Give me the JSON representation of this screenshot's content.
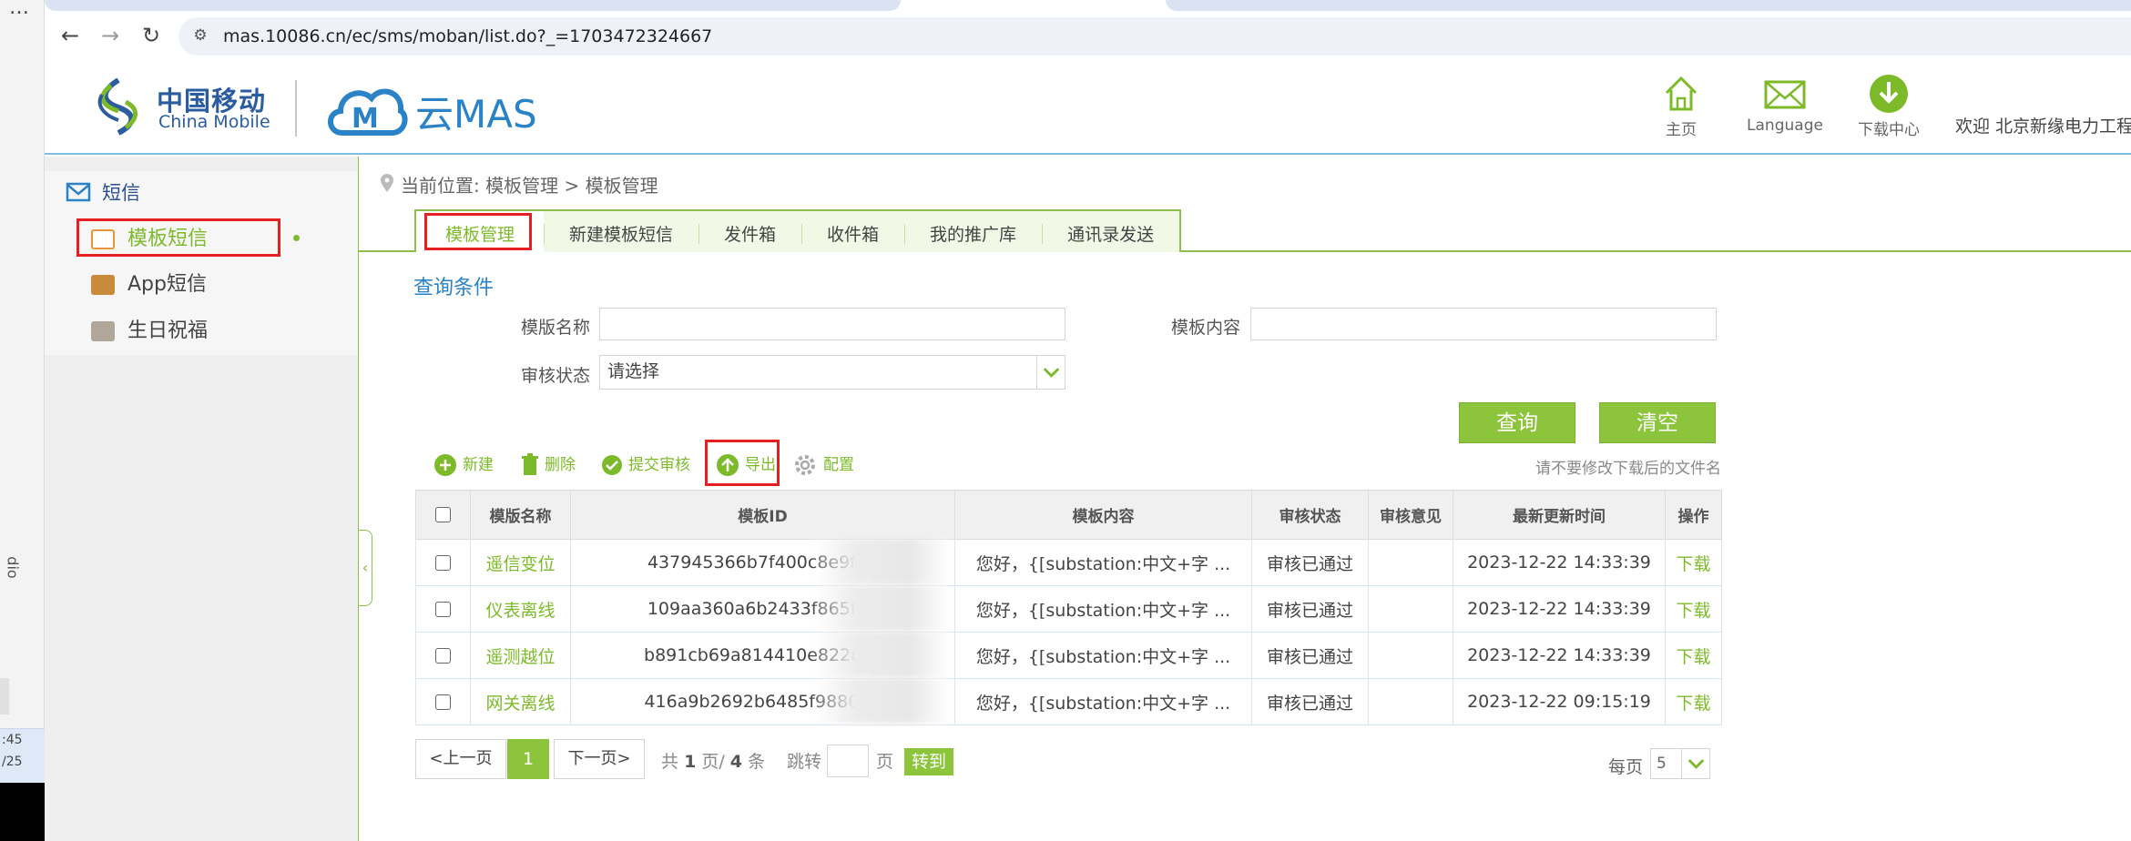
{
  "browser": {
    "menu_glyph": "…",
    "url": "mas.10086.cn/ec/sms/moban/list.do?_=1703472324667",
    "back_glyph": "←",
    "forward_glyph": "→",
    "reload_glyph": "↻",
    "site_info_glyph": "⚙"
  },
  "desktop": {
    "side_text": "dio",
    "clock_time": ":45",
    "clock_date": "/25"
  },
  "header": {
    "cm_zh": "中国移动",
    "cm_en": "China Mobile",
    "mas_text": "云MAS",
    "nav": [
      {
        "label": "主页",
        "icon": "home-icon"
      },
      {
        "label": "Language",
        "icon": "envelope-icon"
      },
      {
        "label": "下载中心",
        "icon": "download-icon"
      }
    ],
    "welcome": "欢迎 北京新缘电力工程"
  },
  "sidebar": {
    "section_title": "短信",
    "items": [
      {
        "label": "模板短信",
        "icon": "template-sms-icon",
        "active": true
      },
      {
        "label": "App短信",
        "icon": "app-sms-icon"
      },
      {
        "label": "生日祝福",
        "icon": "birthday-icon"
      }
    ],
    "collapse_glyph": "‹"
  },
  "breadcrumb": "当前位置: 模板管理 > 模板管理",
  "tabs": [
    "模板管理",
    "新建模板短信",
    "发件箱",
    "收件箱",
    "我的推广库",
    "通讯录发送"
  ],
  "query": {
    "title": "查询条件",
    "name_label": "模版名称",
    "content_label": "模板内容",
    "status_label": "审核状态",
    "status_value": "请选择",
    "search_btn": "查询",
    "clear_btn": "清空"
  },
  "actions": {
    "new": "新建",
    "delete": "删除",
    "submit": "提交审核",
    "export": "导出",
    "config": "配置",
    "hint": "请不要修改下载后的文件名"
  },
  "table": {
    "headers": [
      "模版名称",
      "模板ID",
      "模板内容",
      "审核状态",
      "审核意见",
      "最新更新时间",
      "操作"
    ],
    "rows": [
      {
        "name": "遥信变位",
        "id": "437945366b7f400c8e9fd0",
        "content": "您好，{[substation:中文+字 ...",
        "status": "审核已通过",
        "opinion": "",
        "time": "2023-12-22 14:33:39",
        "op": "下载"
      },
      {
        "name": "仪表离线",
        "id": "109aa360a6b2433f865fa5",
        "content": "您好，{[substation:中文+字 ...",
        "status": "审核已通过",
        "opinion": "",
        "time": "2023-12-22 14:33:39",
        "op": "下载"
      },
      {
        "name": "遥测越位",
        "id": "b891cb69a814410e822cee",
        "content": "您好，{[substation:中文+字 ...",
        "status": "审核已通过",
        "opinion": "",
        "time": "2023-12-22 14:33:39",
        "op": "下载"
      },
      {
        "name": "网关离线",
        "id": "416a9b2692b6485f988009",
        "content": "您好，{[substation:中文+字 ...",
        "status": "审核已通过",
        "opinion": "",
        "time": "2023-12-22 09:15:19",
        "op": "下载"
      }
    ]
  },
  "pager": {
    "prev": "<上一页",
    "current": "1",
    "next": "下一页>",
    "total_prefix": "共",
    "total_pages": "1",
    "total_mid": "页/",
    "total_count": "4",
    "total_suffix": "条",
    "jump_label": "跳转",
    "page_unit": "页",
    "go": "转到",
    "per_page_label": "每页",
    "per_page_value": "5"
  },
  "colors": {
    "accent_green": "#8cc43c",
    "link_blue": "#2a82c7",
    "highlight_red": "#e62020"
  }
}
